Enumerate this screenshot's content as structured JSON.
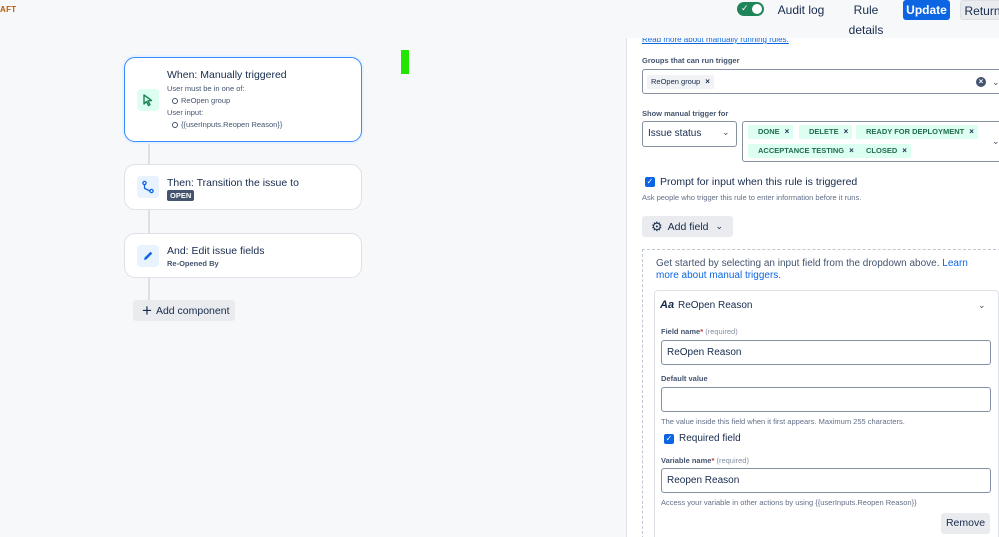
{
  "topbar": {
    "draft_label": "AFT",
    "audit_log": "Audit log",
    "rule_details": "Rule details",
    "update": "Update",
    "return": "Return",
    "toggle_on": true,
    "accent": "#0c66e4"
  },
  "canvas": {
    "trigger": {
      "title": "When: Manually triggered",
      "must_be": "User must be in one of:",
      "group": "ReOpen group",
      "input_label": "User input:",
      "input_value": "{{userInputs.Reopen Reason}}"
    },
    "transition": {
      "title": "Then: Transition the issue to",
      "status": "OPEN"
    },
    "edit": {
      "title": "And: Edit issue fields",
      "field": "Re-Opened By"
    },
    "add_component": "Add component"
  },
  "panel": {
    "cut_link": "Read more about manually running rules.",
    "groups_label": "Groups that can run trigger",
    "groups": [
      "ReOpen group"
    ],
    "show_trigger_label": "Show manual trigger for",
    "show_select": "Issue status",
    "statuses_row1": [
      "DONE",
      "DELETE",
      "READY FOR DEPLOYMENT"
    ],
    "statuses_row2": [
      "ACCEPTANCE TESTING",
      "CLOSED"
    ],
    "prompt_checkbox": "Prompt for input when this rule is triggered",
    "prompt_help": "Ask people who trigger this rule to enter information before it runs.",
    "add_field": "Add field",
    "intro_text": "Get started by selecting an input field from the dropdown above.",
    "intro_link": "Learn more about manual triggers.",
    "input": {
      "type_icon": "Aa",
      "header": "ReOpen Reason",
      "field_name_label": "Field name",
      "required_hint": "(required)",
      "field_name_value": "ReOpen Reason",
      "default_label": "Default value",
      "default_value": "",
      "default_help": "The value inside this field when it first appears. Maximum 255 characters.",
      "required_checkbox": "Required field",
      "variable_label": "Variable name",
      "variable_value": "Reopen Reason",
      "variable_help": "Access your variable in other actions by using {{userInputs.Reopen Reason}}",
      "remove": "Remove"
    }
  }
}
